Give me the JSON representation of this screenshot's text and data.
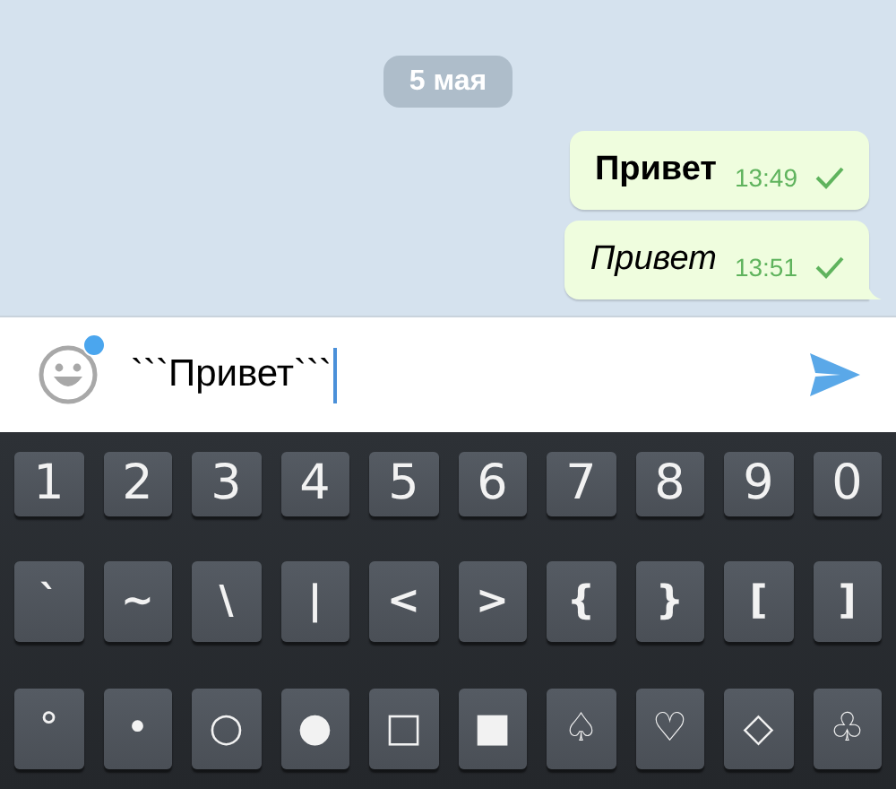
{
  "date_badge": "5 мая",
  "messages": [
    {
      "text": "Привет",
      "kind": "bold",
      "time": "13:49",
      "read": false,
      "tail": false
    },
    {
      "text": "Привет",
      "kind": "italic",
      "time": "13:51",
      "read": false,
      "tail": true
    }
  ],
  "composer": {
    "value": "```Привет```",
    "emoji_badge": true
  },
  "keyboard": {
    "rows": [
      [
        "1",
        "2",
        "3",
        "4",
        "5",
        "6",
        "7",
        "8",
        "9",
        "0"
      ],
      [
        "`",
        "~",
        "\\",
        "|",
        "<",
        ">",
        "{",
        "}",
        "[",
        "]"
      ],
      [
        "°",
        "•",
        "○",
        "●",
        "□",
        "■",
        "♤",
        "♡",
        "◇",
        "♧"
      ]
    ]
  }
}
